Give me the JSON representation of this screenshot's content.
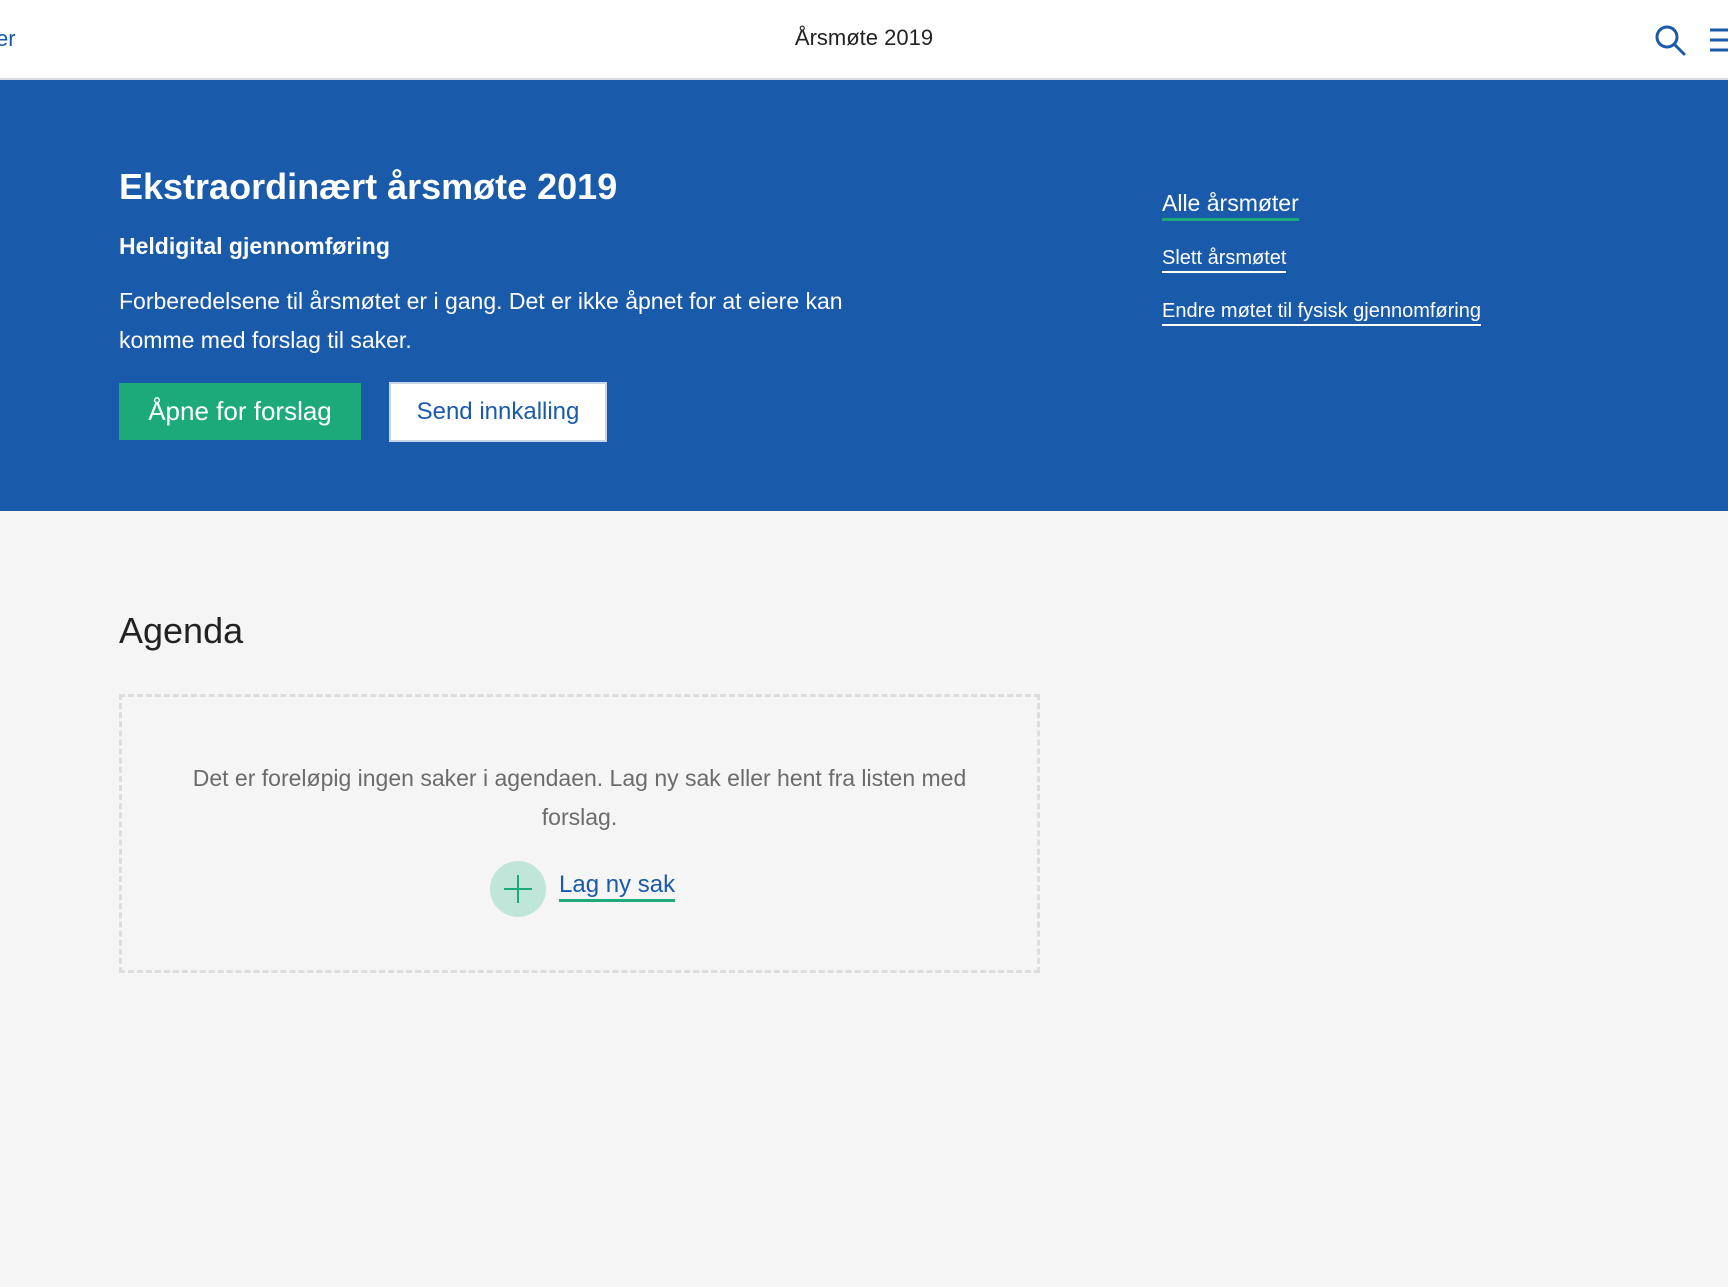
{
  "topbar": {
    "back_fragment": "er",
    "title": "Årsmøte 2019",
    "search_icon": "search-icon",
    "menu_icon": "hamburger-menu-icon"
  },
  "hero": {
    "title": "Ekstraordinært årsmøte 2019",
    "subtitle": "Heldigital gjennomføring",
    "description": "Forberedelsene til årsmøtet er i gang. Det er ikke åpnet for at eiere kan komme med forslag til saker.",
    "open_button_label": "Åpne for forslag",
    "send_button_label": "Send innkalling",
    "links": {
      "all_meetings": "Alle årsmøter",
      "delete_meeting": "Slett årsmøtet",
      "change_to_physical": "Endre møtet til fysisk gjennomføring"
    }
  },
  "agenda": {
    "title": "Agenda",
    "empty_text": "Det er foreløpig ingen saker i agendaen. Lag ny sak eller hent fra listen med forslag.",
    "add_label": "Lag ny sak",
    "add_icon": "plus-icon"
  },
  "colors": {
    "brand_blue": "#1a5aaa",
    "accent_green": "#1daa7a",
    "light_green": "#bfe6d8",
    "background": "#f5f5f5"
  }
}
